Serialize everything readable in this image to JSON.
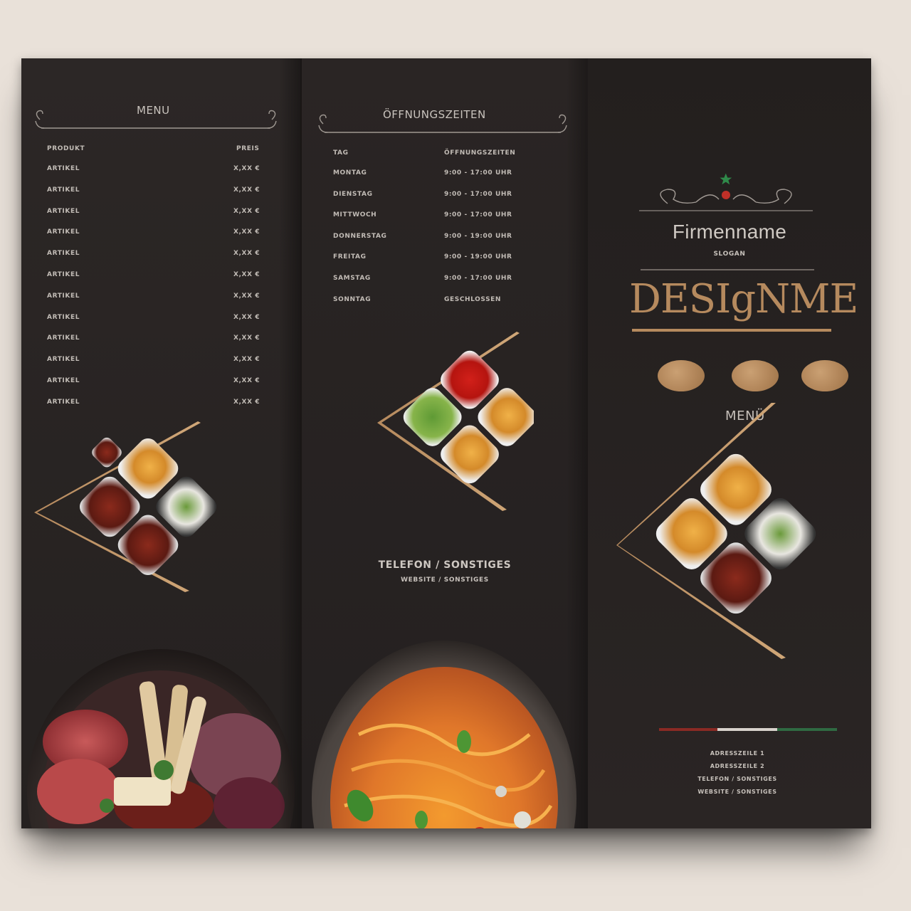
{
  "colors": {
    "accent": "#b68a5e",
    "panel": "#272221",
    "text": "#c9c3bd"
  },
  "panel1": {
    "heading": "Menu",
    "table_header": {
      "product": "Produkt",
      "price": "Preis"
    },
    "rows": [
      {
        "item": "Artikel",
        "price": "X,XX €"
      },
      {
        "item": "Artikel",
        "price": "X,XX €"
      },
      {
        "item": "Artikel",
        "price": "X,XX €"
      },
      {
        "item": "Artikel",
        "price": "X,XX €"
      },
      {
        "item": "Artikel",
        "price": "X,XX €"
      },
      {
        "item": "Artikel",
        "price": "X,XX €"
      },
      {
        "item": "Artikel",
        "price": "X,XX €"
      },
      {
        "item": "Artikel",
        "price": "X,XX €"
      },
      {
        "item": "Artikel",
        "price": "X,XX €"
      },
      {
        "item": "Artikel",
        "price": "X,XX €"
      },
      {
        "item": "Artikel",
        "price": "X,XX €"
      },
      {
        "item": "Artikel",
        "price": "X,XX €"
      }
    ]
  },
  "panel2": {
    "heading": "Öffnungszeiten",
    "table_header": {
      "day": "Tag",
      "hours": "Öffnungszeiten"
    },
    "rows": [
      {
        "day": "Montag",
        "hours": "9:00 - 17:00 Uhr"
      },
      {
        "day": "Dienstag",
        "hours": "9:00 - 17:00 Uhr"
      },
      {
        "day": "Mittwoch",
        "hours": "9:00 - 17:00 Uhr"
      },
      {
        "day": "Donnerstag",
        "hours": "9:00 - 19:00 Uhr"
      },
      {
        "day": "Freitag",
        "hours": "9:00 - 19:00 Uhr"
      },
      {
        "day": "Samstag",
        "hours": "9:00 - 17:00 Uhr"
      },
      {
        "day": "Sonntag",
        "hours": "Geschlossen"
      }
    ],
    "contact_title": "Telefon / Sonstiges",
    "contact_sub": "Website / Sonstiges"
  },
  "panel3": {
    "company_name": "Firmenname",
    "slogan": "Slogan",
    "brand": "DESIgNME",
    "menu_label": "MENÜ",
    "footer_lines": [
      "Adresszeile 1",
      "Adresszeile 2",
      "Telefon / Sonstiges",
      "Website / Sonstiges"
    ]
  },
  "icons": {
    "ornament": "scroll-divider-icon",
    "food_tiles": "food-photo-tiles",
    "charcuterie": "charcuterie-bowl-image",
    "pasta": "pasta-bowl-image"
  }
}
